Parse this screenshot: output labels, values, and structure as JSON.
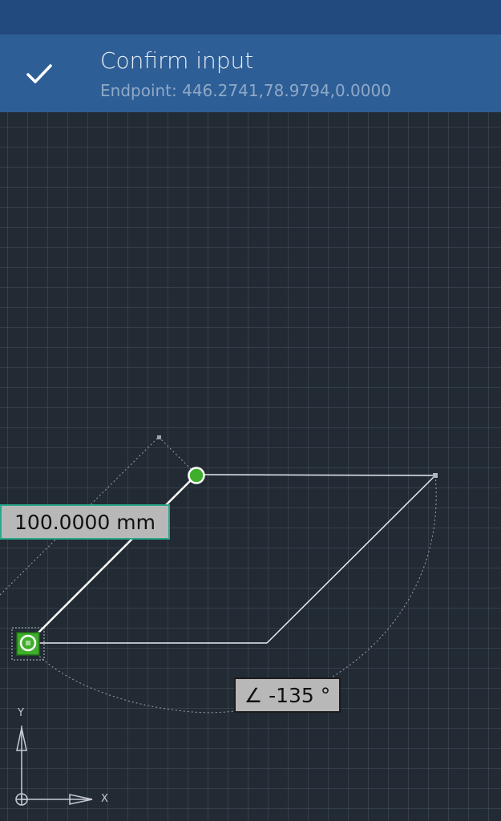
{
  "confirm": {
    "title": "Confirm input",
    "subtitle": "Endpoint: 446.2741,78.9794,0.0000",
    "check_icon": "checkmark-icon"
  },
  "dimensions": {
    "length": "100.0000 mm",
    "angle": "∠ -135 °"
  },
  "axes": {
    "y_label": "Y",
    "x_label": "X"
  },
  "colors": {
    "statusbar": "#234a7e",
    "confirm_bar": "#2e5e96",
    "canvas": "#222a33",
    "grip": "#3fae2c"
  }
}
